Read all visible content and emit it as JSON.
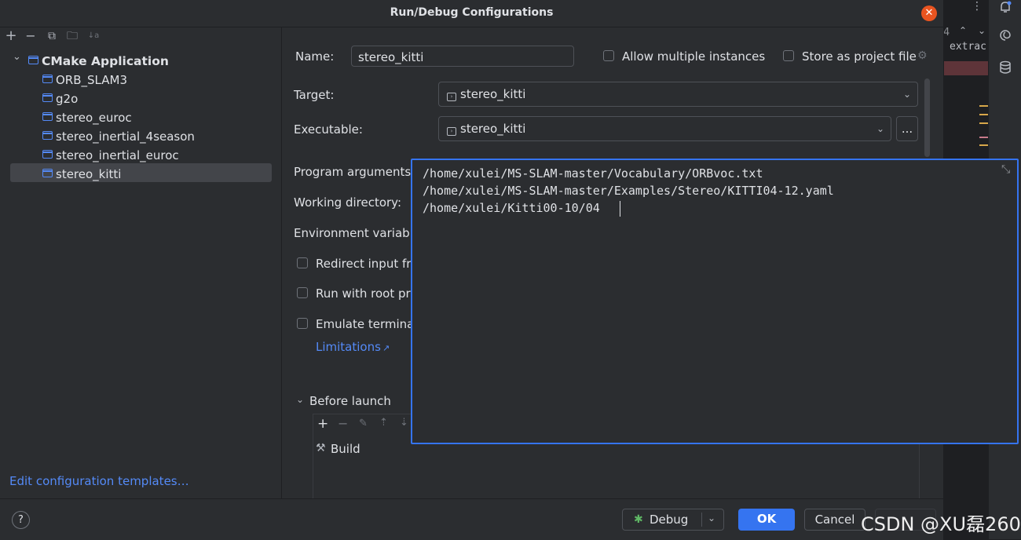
{
  "dialog": {
    "title": "Run/Debug Configurations",
    "close_glyph": "✕"
  },
  "toolbar": {
    "add": "+",
    "remove": "−",
    "copy": "⧉",
    "folder": "🗀",
    "sort": "↓a"
  },
  "tree": {
    "group_arrow": "⌄",
    "group_label": "CMake Application",
    "items": [
      "ORB_SLAM3",
      "g2o",
      "stereo_euroc",
      "stereo_inertial_4season",
      "stereo_inertial_euroc",
      "stereo_kitti"
    ],
    "selected": "stereo_kitti"
  },
  "edit_templates": "Edit configuration templates…",
  "form": {
    "name_label": "Name:",
    "name_value": "stereo_kitti",
    "allow_multiple": "Allow multiple instances",
    "store_project": "Store as project file",
    "target_label": "Target:",
    "target_value": "stereo_kitti",
    "executable_label": "Executable:",
    "executable_value": "stereo_kitti",
    "browse": "...",
    "program_args_label": "Program arguments",
    "working_dir_label": "Working directory:",
    "env_label": "Environment variab",
    "redirect_label": "Redirect input fr",
    "root_label": "Run with root pr",
    "emulate_label": "Emulate termina",
    "limitations": "Limitations",
    "limitations_arrow": "↗",
    "before_launch": "Before launch",
    "build": "Build"
  },
  "popup": {
    "lines": [
      "/home/xulei/MS-SLAM-master/Vocabulary/ORBvoc.txt",
      "/home/xulei/MS-SLAM-master/Examples/Stereo/KITTI04-12.yaml",
      "/home/xulei/Kitti00-10/04"
    ],
    "collapse_glyph": "⤡"
  },
  "footer": {
    "help": "?",
    "debug": "Debug",
    "ok": "OK",
    "cancel": "Cancel"
  },
  "editor": {
    "line_fragment": "4",
    "code_fragment": "extrac"
  },
  "watermark": "CSDN @XU磊260",
  "colors": {
    "accent": "#3574f0",
    "link": "#548af7",
    "close": "#e95420"
  }
}
